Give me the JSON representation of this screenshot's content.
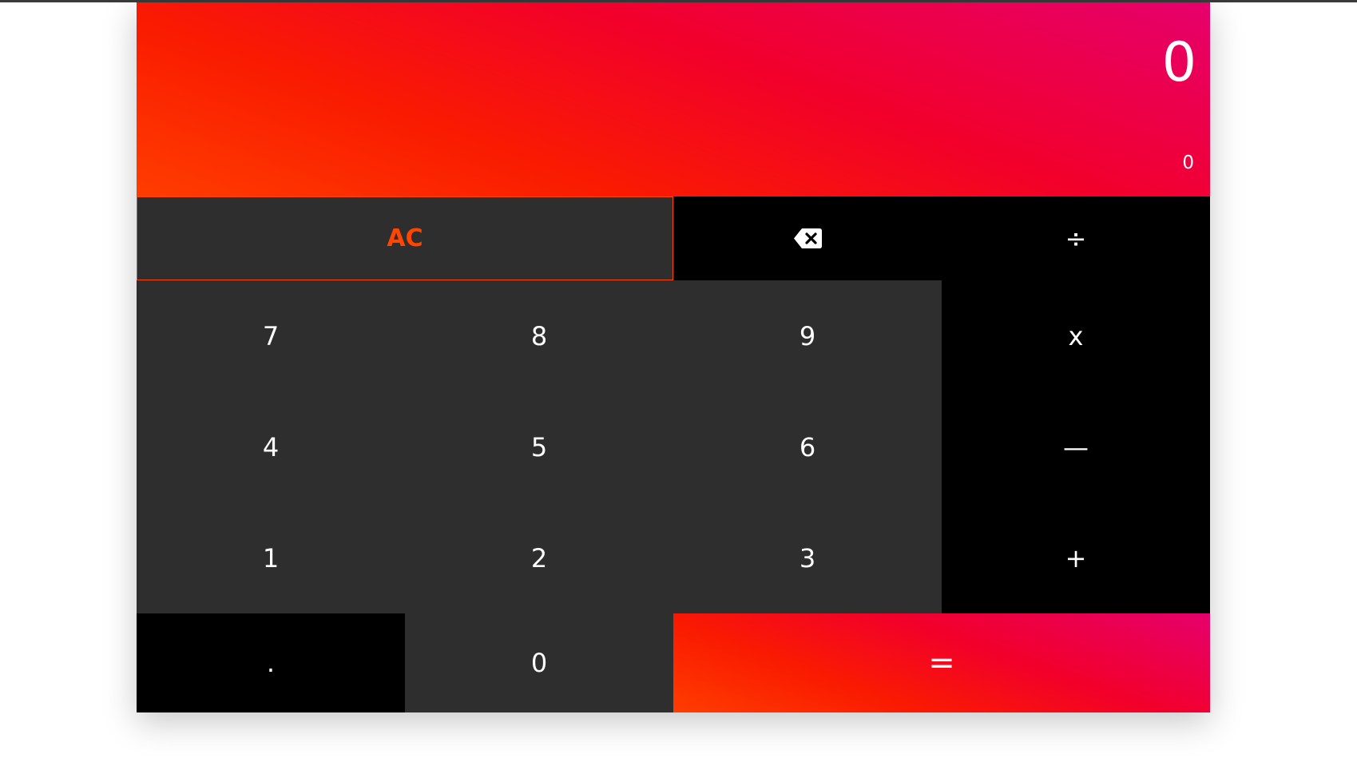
{
  "display": {
    "current": "0",
    "previous": "0"
  },
  "keys": {
    "clear": "AC",
    "divide": "÷",
    "multiply": "x",
    "subtract": "—",
    "add": "+",
    "equals": "=",
    "decimal": ".",
    "d0": "0",
    "d1": "1",
    "d2": "2",
    "d3": "3",
    "d4": "4",
    "d5": "5",
    "d6": "6",
    "d7": "7",
    "d8": "8",
    "d9": "9"
  },
  "icons": {
    "backspace": "backspace-icon"
  },
  "colors": {
    "accent": "#ff4500",
    "gradient_start": "#ff3d00",
    "gradient_end": "#e6006c",
    "key_dark": "#2e2e2e",
    "key_black": "#000000"
  }
}
